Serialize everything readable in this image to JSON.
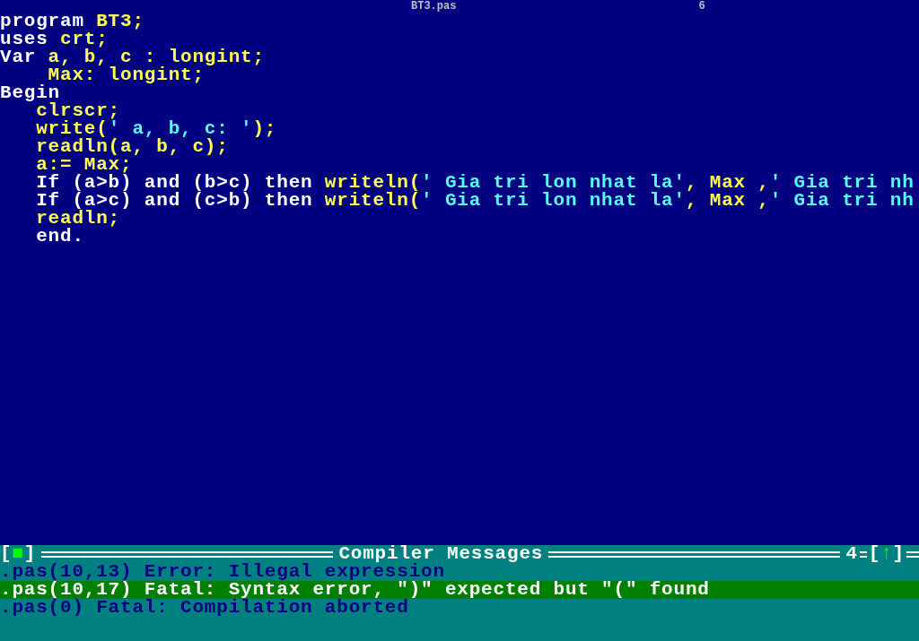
{
  "editor": {
    "title": "BT3.pas",
    "window_number": "6",
    "lines": [
      [
        {
          "kind": "keyword",
          "text": "program "
        },
        {
          "kind": "ident",
          "text": "BT3;"
        }
      ],
      [
        {
          "kind": "keyword",
          "text": "uses "
        },
        {
          "kind": "ident",
          "text": "crt;"
        }
      ],
      [
        {
          "kind": "keyword",
          "text": "Var "
        },
        {
          "kind": "ident",
          "text": "a, b, c : longint;"
        }
      ],
      [
        {
          "kind": "ident",
          "text": "    Max: longint;"
        }
      ],
      [
        {
          "kind": "keyword",
          "text": "Begin"
        }
      ],
      [
        {
          "kind": "ident",
          "text": "   clrscr;"
        }
      ],
      [
        {
          "kind": "ident",
          "text": "   write("
        },
        {
          "kind": "string",
          "text": "' a, b, c: '"
        },
        {
          "kind": "ident",
          "text": ");"
        }
      ],
      [
        {
          "kind": "ident",
          "text": "   readln(a, b, c);"
        }
      ],
      [
        {
          "kind": "ident",
          "text": "   a:= Max;"
        }
      ],
      [
        {
          "kind": "keyword",
          "text": "   If (a>b) and (b>c) then "
        },
        {
          "kind": "ident",
          "text": "writeln("
        },
        {
          "kind": "string",
          "text": "' Gia tri lon nhat la'"
        },
        {
          "kind": "ident",
          "text": ", Max ,"
        },
        {
          "kind": "string",
          "text": "' Gia tri nh"
        }
      ],
      [
        {
          "kind": "keyword",
          "text": "   If (a>c) and (c>b) then "
        },
        {
          "kind": "ident",
          "text": "writeln("
        },
        {
          "kind": "string",
          "text": "' Gia tri lon nhat la'"
        },
        {
          "kind": "ident",
          "text": ", Max ,"
        },
        {
          "kind": "string",
          "text": "' Gia tri nh"
        }
      ],
      [
        {
          "kind": "ident",
          "text": "   readln;"
        }
      ],
      [
        {
          "kind": "keyword",
          "text": "   end."
        }
      ]
    ]
  },
  "messages": {
    "close_button": {
      "left": "[",
      "glyph": "■",
      "right": "]"
    },
    "title": "Compiler Messages",
    "window_number": "4",
    "zoom_button": {
      "left": "[",
      "glyph": "↑",
      "right": "]"
    },
    "items": [
      {
        "text": ".pas(10,13) Error: Illegal expression",
        "selected": false
      },
      {
        "text": ".pas(10,17) Fatal: Syntax error, \")\" expected but \"(\" found",
        "selected": true
      },
      {
        "text": ".pas(0) Fatal: Compilation aborted",
        "selected": false
      }
    ]
  }
}
